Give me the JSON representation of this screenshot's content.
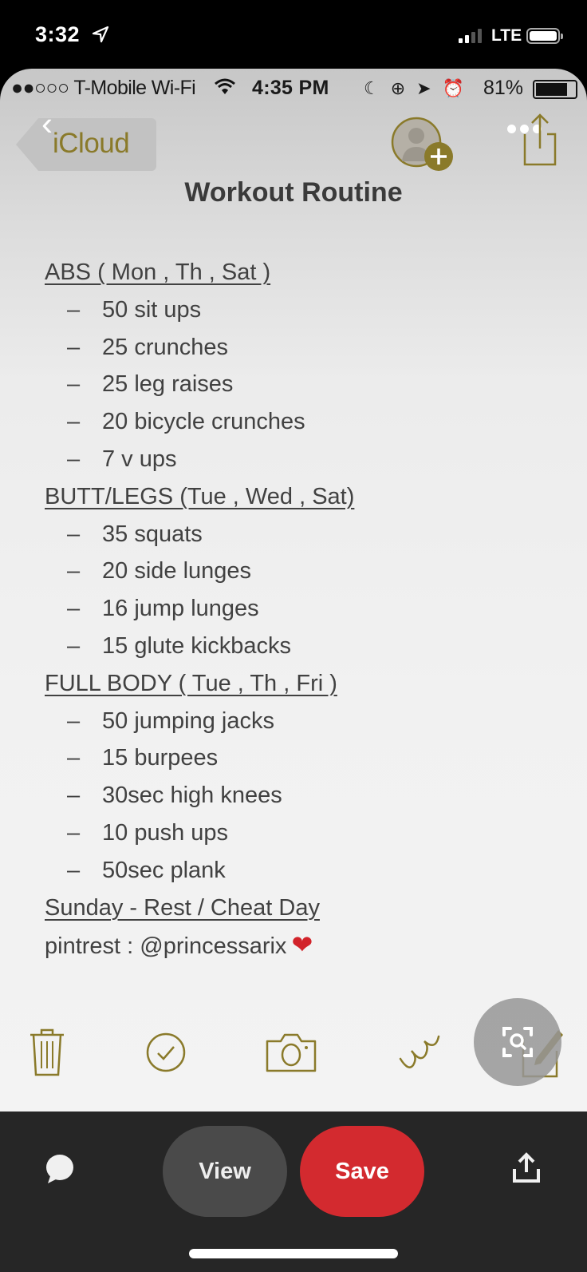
{
  "outer_status": {
    "time": "3:32",
    "network": "LTE",
    "signal_bars_active": 2,
    "signal_bars_total": 4
  },
  "inner_status": {
    "carrier": "●●○○○ T-Mobile Wi-Fi",
    "time": "4:35 PM",
    "battery_percent": "81%",
    "icons": [
      "moon-icon",
      "rotation-lock-icon",
      "location-icon",
      "alarm-icon"
    ]
  },
  "note_nav": {
    "back_label": "iCloud",
    "title": "Workout Routine"
  },
  "note": {
    "sections": [
      {
        "heading": "ABS ( Mon , Th , Sat )",
        "items": [
          "50 sit ups",
          "25 crunches",
          "25 leg raises",
          "20 bicycle crunches",
          "7 v ups"
        ]
      },
      {
        "heading": "BUTT/LEGS (Tue , Wed , Sat)",
        "items": [
          "35 squats",
          "20 side lunges",
          "16 jump lunges",
          "15 glute kickbacks"
        ]
      },
      {
        "heading": "FULL BODY ( Tue , Th , Fri )",
        "items": [
          "50 jumping jacks",
          "15 burpees",
          "30sec high knees",
          "10 push ups",
          "50sec plank"
        ]
      }
    ],
    "rest_day": "Sunday - Rest / Cheat Day",
    "credit": "pintrest : @princessarix",
    "credit_emoji": "❤",
    "bullet_char": "–"
  },
  "bottom_bar": {
    "view_label": "View",
    "save_label": "Save"
  },
  "colors": {
    "accent_gold": "#8a7a2a",
    "save_red": "#d32a2f",
    "view_gray": "#4a4a4a",
    "bar_bg": "#262626"
  }
}
